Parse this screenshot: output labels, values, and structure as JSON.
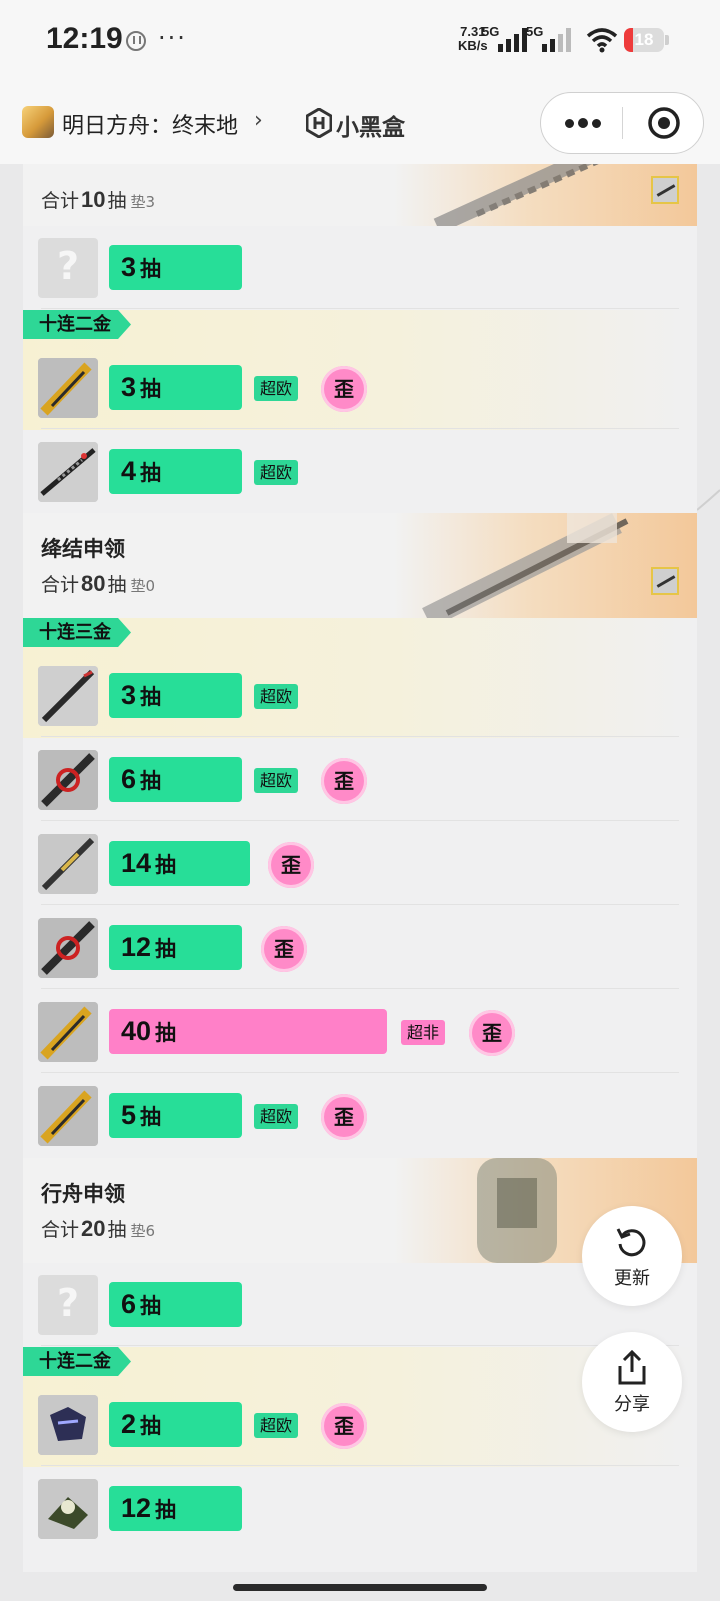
{
  "status_bar": {
    "time": "12:19",
    "dots": "···",
    "net_speed": "7.31",
    "net_unit": "KB/s",
    "sim1": "5G",
    "sim2": "5G",
    "battery": "18",
    "icons": [
      "app-notification-icon",
      "signal-icon",
      "wifi-icon",
      "battery-icon"
    ]
  },
  "header": {
    "app_name": "明日方舟：终末地",
    "chevron": "›",
    "brand": "小黑盒",
    "icons": [
      "more-icon",
      "close-target-icon"
    ]
  },
  "sections": [
    {
      "name": "",
      "total_prefix": "合计",
      "total": "10",
      "total_suffix": "抽",
      "pad": "垫3",
      "bands": [
        {
          "label": "十连二金"
        }
      ],
      "rows": [
        {
          "pulls": "3",
          "unit": "抽",
          "unknown": true,
          "badge": "",
          "wai": ""
        },
        {
          "pulls": "3",
          "unit": "抽",
          "badge": "超欧",
          "wai": "歪"
        },
        {
          "pulls": "4",
          "unit": "抽",
          "badge": "超欧",
          "wai": ""
        }
      ]
    },
    {
      "name": "绛结申领",
      "total_prefix": "合计",
      "total": "80",
      "total_suffix": "抽",
      "pad": "垫0",
      "bands": [
        {
          "label": "十连三金"
        }
      ],
      "rows": [
        {
          "pulls": "3",
          "unit": "抽",
          "badge": "超欧",
          "wai": ""
        },
        {
          "pulls": "6",
          "unit": "抽",
          "badge": "超欧",
          "wai": "歪"
        },
        {
          "pulls": "14",
          "unit": "抽",
          "badge": "",
          "wai": "歪"
        },
        {
          "pulls": "12",
          "unit": "抽",
          "badge": "",
          "wai": "歪"
        },
        {
          "pulls": "40",
          "unit": "抽",
          "badge": "超非",
          "wai": "歪",
          "bar_color": "#ff80c8"
        },
        {
          "pulls": "5",
          "unit": "抽",
          "badge": "超欧",
          "wai": "歪"
        }
      ]
    },
    {
      "name": "行舟申领",
      "total_prefix": "合计",
      "total": "20",
      "total_suffix": "抽",
      "pad": "垫6",
      "bands": [
        {
          "label": "十连二金"
        }
      ],
      "rows": [
        {
          "pulls": "6",
          "unit": "抽",
          "unknown": true,
          "badge": "",
          "wai": ""
        },
        {
          "pulls": "2",
          "unit": "抽",
          "badge": "超欧",
          "wai": "歪"
        },
        {
          "pulls": "12",
          "unit": "抽",
          "badge": "",
          "wai": ""
        }
      ]
    }
  ],
  "fabs": {
    "refresh": "更新",
    "share": "分享"
  },
  "colors": {
    "green": "#27de98",
    "pink": "#ff80c8",
    "band": "#f7f1d3"
  }
}
